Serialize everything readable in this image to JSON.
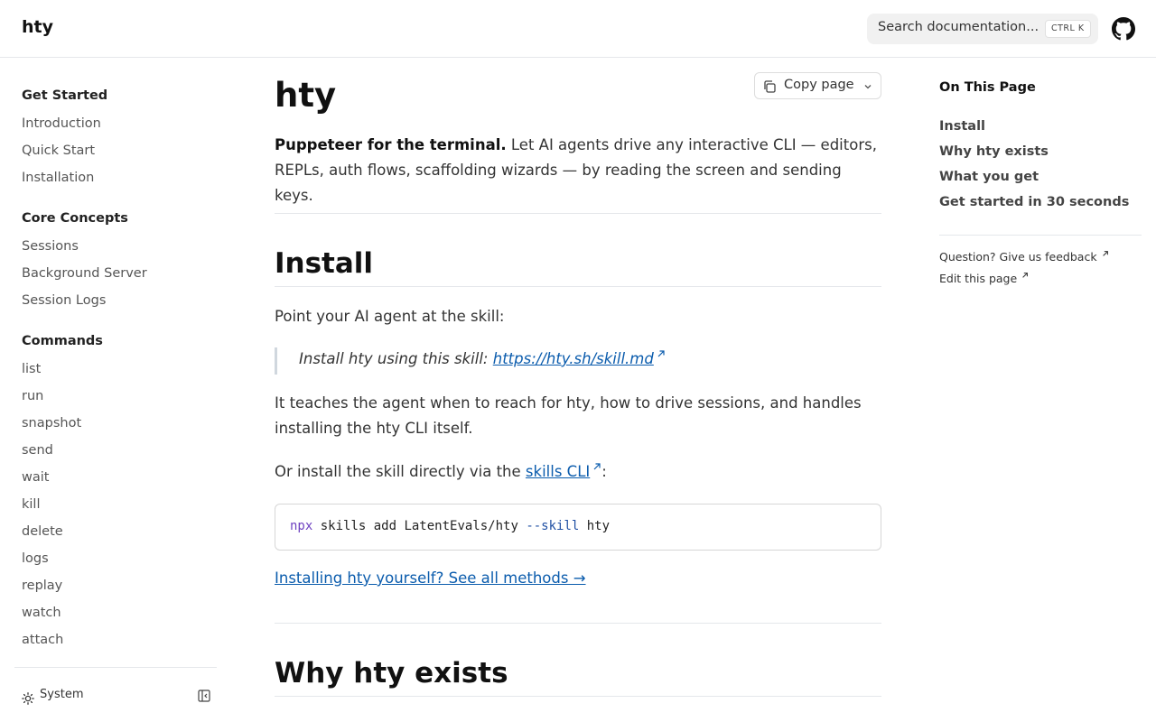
{
  "header": {
    "brand": "hty",
    "search_placeholder": "Search documentation...",
    "shortcut": "CTRL K",
    "github_icon": "github-icon"
  },
  "sidebar": {
    "groups": [
      {
        "title": "Get Started",
        "items": [
          "Introduction",
          "Quick Start",
          "Installation"
        ]
      },
      {
        "title": "Core Concepts",
        "items": [
          "Sessions",
          "Background Server",
          "Session Logs"
        ]
      },
      {
        "title": "Commands",
        "items": [
          "list",
          "run",
          "snapshot",
          "send",
          "wait",
          "kill",
          "delete",
          "logs",
          "replay",
          "watch",
          "attach"
        ]
      }
    ],
    "theme_label": "System"
  },
  "main": {
    "title": "hty",
    "copy_label": "Copy page",
    "lead_bold": "Puppeteer for the terminal.",
    "lead_rest": " Let AI agents drive any interactive CLI — editors, REPLs, auth flows, scaffolding wizards — by reading the screen and sending keys.",
    "install_heading": "Install",
    "install_intro": "Point your AI agent at the skill:",
    "quote_text": "Install hty using this skill: ",
    "quote_link": "https://hty.sh/skill.md",
    "teaches": "It teaches the agent when to reach for hty, how to drive sessions, and handles installing the hty CLI itself.",
    "or_install": "Or install the skill directly via the ",
    "skills_cli_link": "skills CLI",
    "or_install_end": ":",
    "code": {
      "cmd": "npx",
      "args": " skills add LatentEvals/hty ",
      "flag": "--skill",
      "tail": " hty"
    },
    "methods_link": "Installing hty yourself? See all methods →",
    "why_heading": "Why hty exists"
  },
  "toc": {
    "title": "On This Page",
    "items": [
      "Install",
      "Why hty exists",
      "What you get",
      "Get started in 30 seconds"
    ],
    "feedback": "Question? Give us feedback",
    "edit": "Edit this page"
  }
}
